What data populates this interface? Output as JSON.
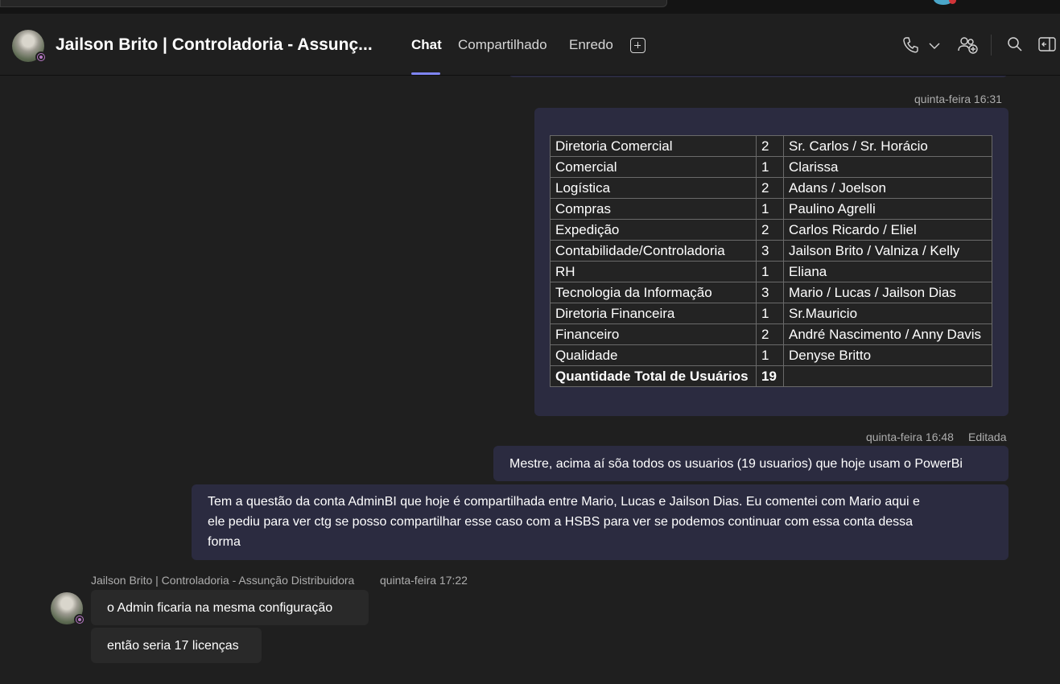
{
  "header": {
    "title": "Jailson Brito | Controladoria - Assunç...",
    "tabs": [
      {
        "label": "Chat",
        "active": true
      },
      {
        "label": "Compartilhado",
        "active": false
      },
      {
        "label": "Enredo",
        "active": false
      }
    ],
    "icons": [
      "add-tab-icon",
      "phone-icon",
      "chevron-down-icon",
      "add-people-icon",
      "search-icon",
      "open-side-panel-icon"
    ]
  },
  "colors": {
    "accent": "#7f85f5",
    "my_bubble": "#2b2b40",
    "other_bubble": "#292929",
    "background": "#1f1f1f"
  },
  "messages": {
    "table_message": {
      "timestamp": "quinta-feira 16:31",
      "rows": [
        {
          "area": "Diretoria Comercial",
          "qty": "2",
          "names": "Sr. Carlos / Sr. Horácio"
        },
        {
          "area": "Comercial",
          "qty": "1",
          "names": "Clarissa"
        },
        {
          "area": "Logística",
          "qty": "2",
          "names": "Adans / Joelson"
        },
        {
          "area": "Compras",
          "qty": "1",
          "names": "Paulino  Agrelli"
        },
        {
          "area": "Expedição",
          "qty": "2",
          "names": "Carlos Ricardo / Eliel"
        },
        {
          "area": "Contabilidade/Controladoria",
          "qty": "3",
          "names": "Jailson Brito / Valniza / Kelly"
        },
        {
          "area": "RH",
          "qty": "1",
          "names": "Eliana"
        },
        {
          "area": "Tecnologia da Informação",
          "qty": "3",
          "names": "Mario / Lucas / Jailson Dias"
        },
        {
          "area": "Diretoria Financeira",
          "qty": "1",
          "names": "Sr.Mauricio"
        },
        {
          "area": "Financeiro",
          "qty": "2",
          "names": "André Nascimento / Anny Davis"
        },
        {
          "area": "Qualidade",
          "qty": "1",
          "names": "Denyse Britto"
        }
      ],
      "total": {
        "area": "Quantidade Total de Usuários",
        "qty": "19",
        "names": ""
      }
    },
    "second": {
      "timestamp": "quinta-feira 16:48",
      "edited": "Editada",
      "text1": "Mestre, acima aí sõa todos os usuarios (19 usuarios) que hoje usam o PowerBi",
      "text2_line1": "Tem a questão da conta AdminBI que hoje é compartilhada entre Mario, Lucas e Jailson Dias. Eu comentei com Mario aqui e",
      "text2_line2": "ele pediu para ver ctg se posso compartilhar esse caso com a HSBS para ver se podemos continuar com essa conta dessa",
      "text2_line3": "forma"
    },
    "reply": {
      "sender": "Jailson Brito | Controladoria - Assunção Distribuidora",
      "timestamp": "quinta-feira 17:22",
      "text1": "o Admin ficaria na mesma configuração",
      "text2": "então seria 17 licenças"
    }
  }
}
